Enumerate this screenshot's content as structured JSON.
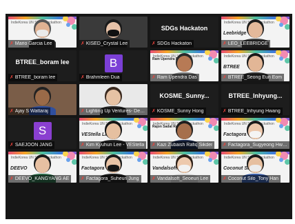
{
  "tiles": [
    {
      "name": "Mario Garcia Lee",
      "kind": "video",
      "active": true,
      "bg": "slide",
      "slide_header": "IndieKorea UN SDGs Hackathon",
      "skin": "#e0b293",
      "hair": "#555555",
      "shirt": "#2c2c2c",
      "mask": "#eaeaea"
    },
    {
      "name": "KISED_Crystal Lee",
      "kind": "video",
      "bg": "#3a3a3a",
      "skin": "#e7c2a8",
      "hair": "#1a1a1a",
      "shirt": "#1f1f1f",
      "mask": "#111111"
    },
    {
      "name": "SDGs Hackaton",
      "kind": "name",
      "display": "SDGs Hackaton",
      "bg": "#1d1d1d"
    },
    {
      "name": "LEO_LEEBRIDGE",
      "kind": "video",
      "bg": "slide",
      "slide_header": "IndieKorea UN SDGs Hackathon",
      "logo": "Leebridge",
      "skin": "#e4b99b",
      "hair": "#1d1d1d",
      "shirt": "#444444"
    },
    {
      "name": "BTREE_boram lee",
      "kind": "name",
      "display": "BTREE_boram lee",
      "bg": "#1d1d1d"
    },
    {
      "name": "Brahmleen Dua",
      "kind": "avatar",
      "letter": "B",
      "avatar_color": "#7b3fd6",
      "bg": "#1d1d1d"
    },
    {
      "name": "Ram Upendra Das",
      "kind": "video",
      "bg": "slide",
      "slide_header": "IndieKorea UN SDGs Hackathon",
      "slide_sub": "Ram Upendra Das",
      "skin": "#b77a55",
      "hair": "#2a2a2a",
      "shirt": "#7a7a7a"
    },
    {
      "name": "BTREE_Seong Eun Eom",
      "kind": "video",
      "bg": "slide",
      "slide_header": "IndieKorea UN SDGs Hackathon",
      "logo": "BTREE",
      "skin": "#e2b696",
      "hair": "#1a1a1a",
      "shirt": "#333333"
    },
    {
      "name": "Ajay S Wattaraj",
      "kind": "video",
      "bg": "#7a5d48",
      "skin": "#9a6a48",
      "hair": "#222222",
      "shirt": "#2f4f9f"
    },
    {
      "name": "Lighting Up Ventures- Devi...",
      "kind": "video",
      "bg": "#e9e9e9",
      "skin": "#e6c2a4",
      "hair": "#3b2a1f",
      "shirt": "#2c2c2c"
    },
    {
      "name": "KOSME_Sunny Hong",
      "kind": "name",
      "display": "KOSME_Sunny...",
      "bg": "#1d1d1d"
    },
    {
      "name": "BTREE_Inhyung Hwang",
      "kind": "name",
      "display": "BTREE_Inhyung...",
      "bg": "#1d1d1d"
    },
    {
      "name": "SAEJOON JANG",
      "kind": "avatar",
      "letter": "S",
      "avatar_color": "#8a3fd0",
      "bg": "#1d1d1d"
    },
    {
      "name": "Kim Kyuhun Lee - VEStella",
      "kind": "video",
      "bg": "slide",
      "slide_header": "IndieKorea UN SDGs Hackathon",
      "logo": "VEStella Lab",
      "skin": "#e6c0a0",
      "hair": "#151515",
      "shirt": "#2a2a2a"
    },
    {
      "name": "Kazi Zubaish Rafiq Sikder",
      "kind": "video",
      "bg": "slide",
      "slide_header": "IndieKorea UN SDGs Hackathon",
      "slide_sub": "Rajon Sadat Raha",
      "skin": "#a66f4c",
      "hair": "#1f1f1f",
      "shirt": "#1e2a4a"
    },
    {
      "name": "Factagora_Sugyeong Hwang",
      "kind": "video",
      "bg": "slide",
      "slide_header": "IndieKorea UN SDGs Hackathon",
      "logo": "Factagora",
      "skin": "#ecc7ab",
      "hair": "#1a1a1a",
      "shirt": "#f0f0f0",
      "mask": "#f4f4f4"
    },
    {
      "name": "DEEVO_KANGYANG AE",
      "kind": "video",
      "bg": "slide",
      "slide_header": "IndieKorea UN SDGs Hackathon",
      "logo": "DEEVO",
      "skin": "#e7c0a2",
      "hair": "#1a1a1a",
      "shirt": "#2e6b4a"
    },
    {
      "name": "Factagora_Suheun Jung",
      "kind": "video",
      "bg": "slide",
      "slide_header": "IndieKorea UN SDGs Hackathon",
      "logo": "Factagora",
      "skin": "#e8c3a6",
      "hair": "#1a1a1a",
      "shirt": "#222222",
      "mask": "#151515"
    },
    {
      "name": "Vandalsoft_Seoeun Lee",
      "kind": "video",
      "bg": "slide",
      "slide_header": "IndieKorea UN SDGs Hackathon",
      "logo": "Vandalsoft",
      "skin": "#edc9ad",
      "hair": "#2a1d15",
      "shirt": "#d9d9d9",
      "mask": "#f2f2f2"
    },
    {
      "name": "Coconut Silo_Tony Han",
      "kind": "video",
      "bg": "slide",
      "slide_header": "IndieKorea UN SDGs Hackathon",
      "logo": "Coconut Silo",
      "skin": "#e6bf9f",
      "hair": "#1a1a1a",
      "shirt": "#3c5fa8",
      "mask": "#ececec"
    }
  ],
  "colors": {
    "active_border": "#9bd23c",
    "muted_mic": "#e8433b"
  },
  "icons": {
    "mic": "mic-muted-icon"
  }
}
